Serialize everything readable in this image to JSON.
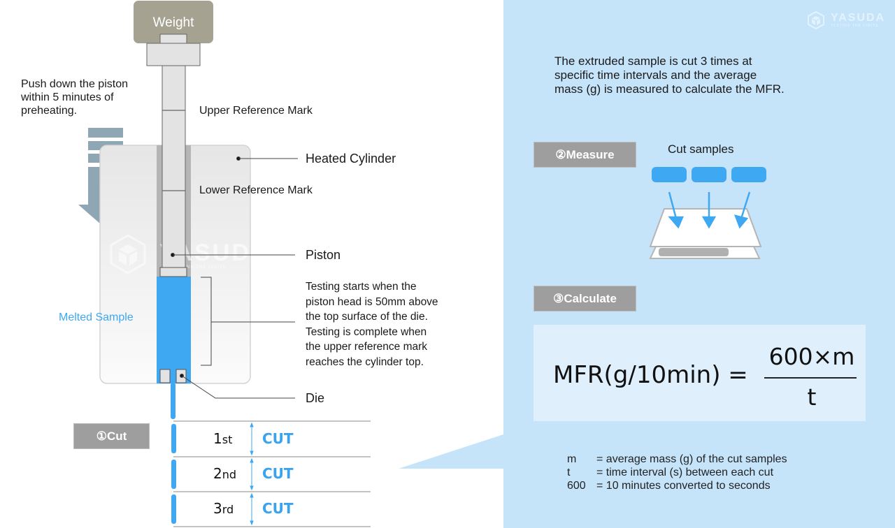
{
  "diagram": {
    "title_left": {
      "weight_label": "Weight",
      "push_note": "Push down the piston\nwithin 5 minutes of\npreheating.",
      "upper_mark": "Upper Reference Mark",
      "heated_cylinder": "Heated Cylinder",
      "lower_mark": "Lower Reference Mark",
      "piston": "Piston",
      "melted_sample": "Melted Sample",
      "testing_note": "Testing starts when the\npiston head is 50mm above\nthe top surface of the die.\nTesting is complete when\nthe upper reference mark\nreaches the cylinder top.",
      "die": "Die"
    },
    "watermark": {
      "brand": "YASUDA",
      "tagline": "TESTING THE LIMITS"
    },
    "steps": {
      "cut": {
        "badge": "①Cut",
        "rows": [
          {
            "num": "1",
            "suffix": "st",
            "action": "CUT"
          },
          {
            "num": "2",
            "suffix": "nd",
            "action": "CUT"
          },
          {
            "num": "3",
            "suffix": "rd",
            "action": "CUT"
          }
        ]
      },
      "measure": {
        "badge": "②Measure",
        "samples_label": "Cut samples"
      },
      "calculate": {
        "badge": "③Calculate",
        "formula_lhs": "MFR(g/10min) =",
        "formula_numerator": "600×m",
        "formula_denominator": "t"
      }
    },
    "intro": "The extruded sample is cut 3 times at\nspecific time intervals and the average\nmass (g) is measured to calculate the MFR.",
    "legend": [
      {
        "symbol": "m",
        "definition": "= average mass (g) of the cut samples"
      },
      {
        "symbol": "t",
        "definition": "= time interval (s) between each cut"
      },
      {
        "symbol": "600",
        "definition": "= 10 minutes converted to seconds"
      }
    ],
    "colors": {
      "panel_bg": "#c5e4fa",
      "formula_bg": "#dff0fc",
      "sample_blue": "#3ea8f2",
      "badge_gray": "#9e9e9e",
      "weight_color": "#a5a292",
      "arrow_color": "#8fa6b5"
    }
  }
}
